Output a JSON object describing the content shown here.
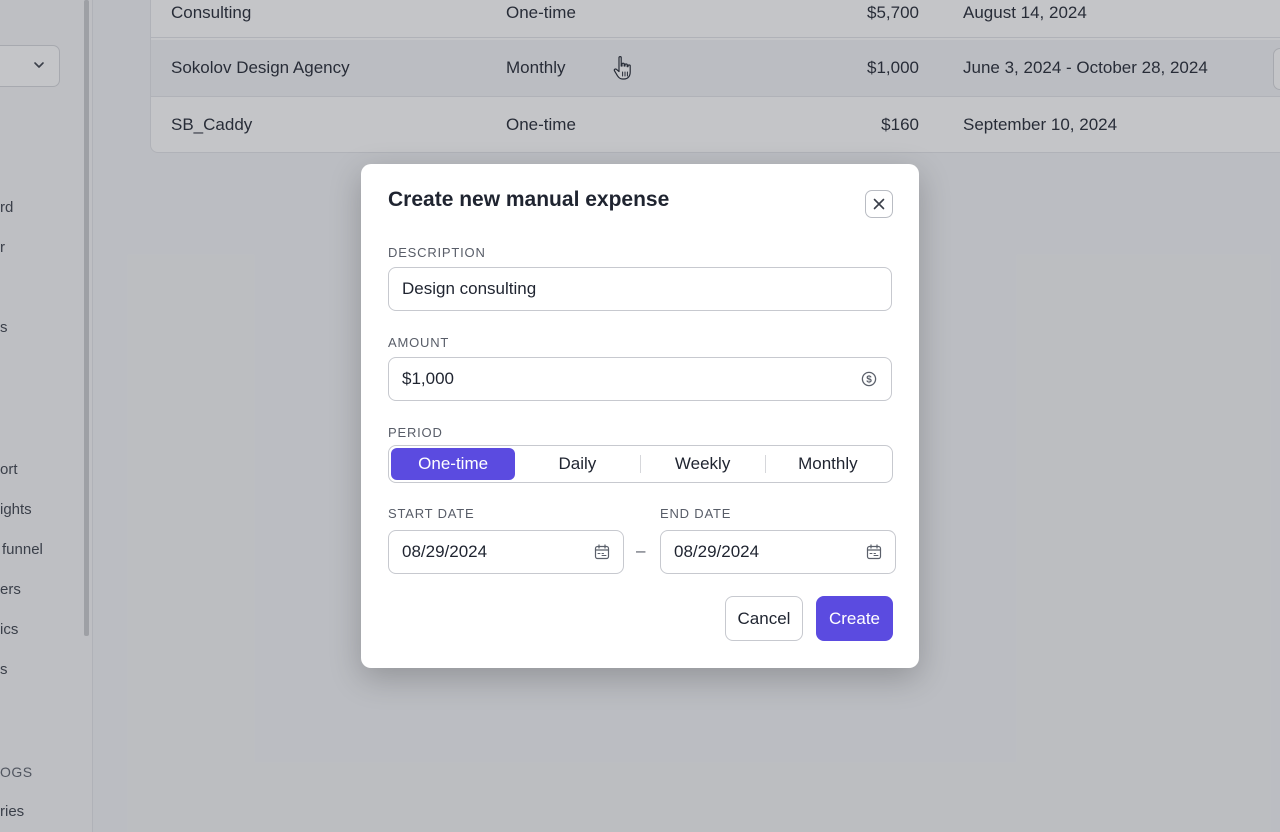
{
  "sidebar": {
    "items": [
      {
        "label": "rd"
      },
      {
        "label": "r"
      },
      {
        "label": "s"
      },
      {
        "label": "ort"
      },
      {
        "label": "ights"
      },
      {
        "label": "funnel"
      },
      {
        "label": "ers"
      },
      {
        "label": "ics"
      },
      {
        "label": "s"
      },
      {
        "label": "OGS"
      },
      {
        "label": "ries"
      }
    ],
    "select_icon": "chevron-down-icon"
  },
  "table": {
    "rows": [
      {
        "name": "Consulting",
        "period": "One-time",
        "amount": "$5,700",
        "date": "August 14, 2024"
      },
      {
        "name": "Sokolov Design Agency",
        "period": "Monthly",
        "amount": "$1,000",
        "date": "June 3, 2024 - October 28, 2024"
      },
      {
        "name": "SB_Caddy",
        "period": "One-time",
        "amount": "$160",
        "date": "September 10, 2024"
      }
    ]
  },
  "modal": {
    "title": "Create new manual expense",
    "close_icon": "close-icon",
    "description": {
      "label": "DESCRIPTION",
      "value": "Design consulting"
    },
    "amount": {
      "label": "AMOUNT",
      "value": "$1,000",
      "icon": "dollar-circle-icon"
    },
    "period": {
      "label": "PERIOD",
      "options": [
        "One-time",
        "Daily",
        "Weekly",
        "Monthly"
      ],
      "selected": "One-time"
    },
    "start_date": {
      "label": "START DATE",
      "value": "08/29/2024",
      "icon": "calendar-icon"
    },
    "end_date": {
      "label": "END DATE",
      "value": "08/29/2024",
      "icon": "calendar-icon"
    },
    "date_separator": "–",
    "cancel_label": "Cancel",
    "create_label": "Create"
  },
  "colors": {
    "accent": "#5b4be0",
    "overlay": "#3c4048"
  }
}
